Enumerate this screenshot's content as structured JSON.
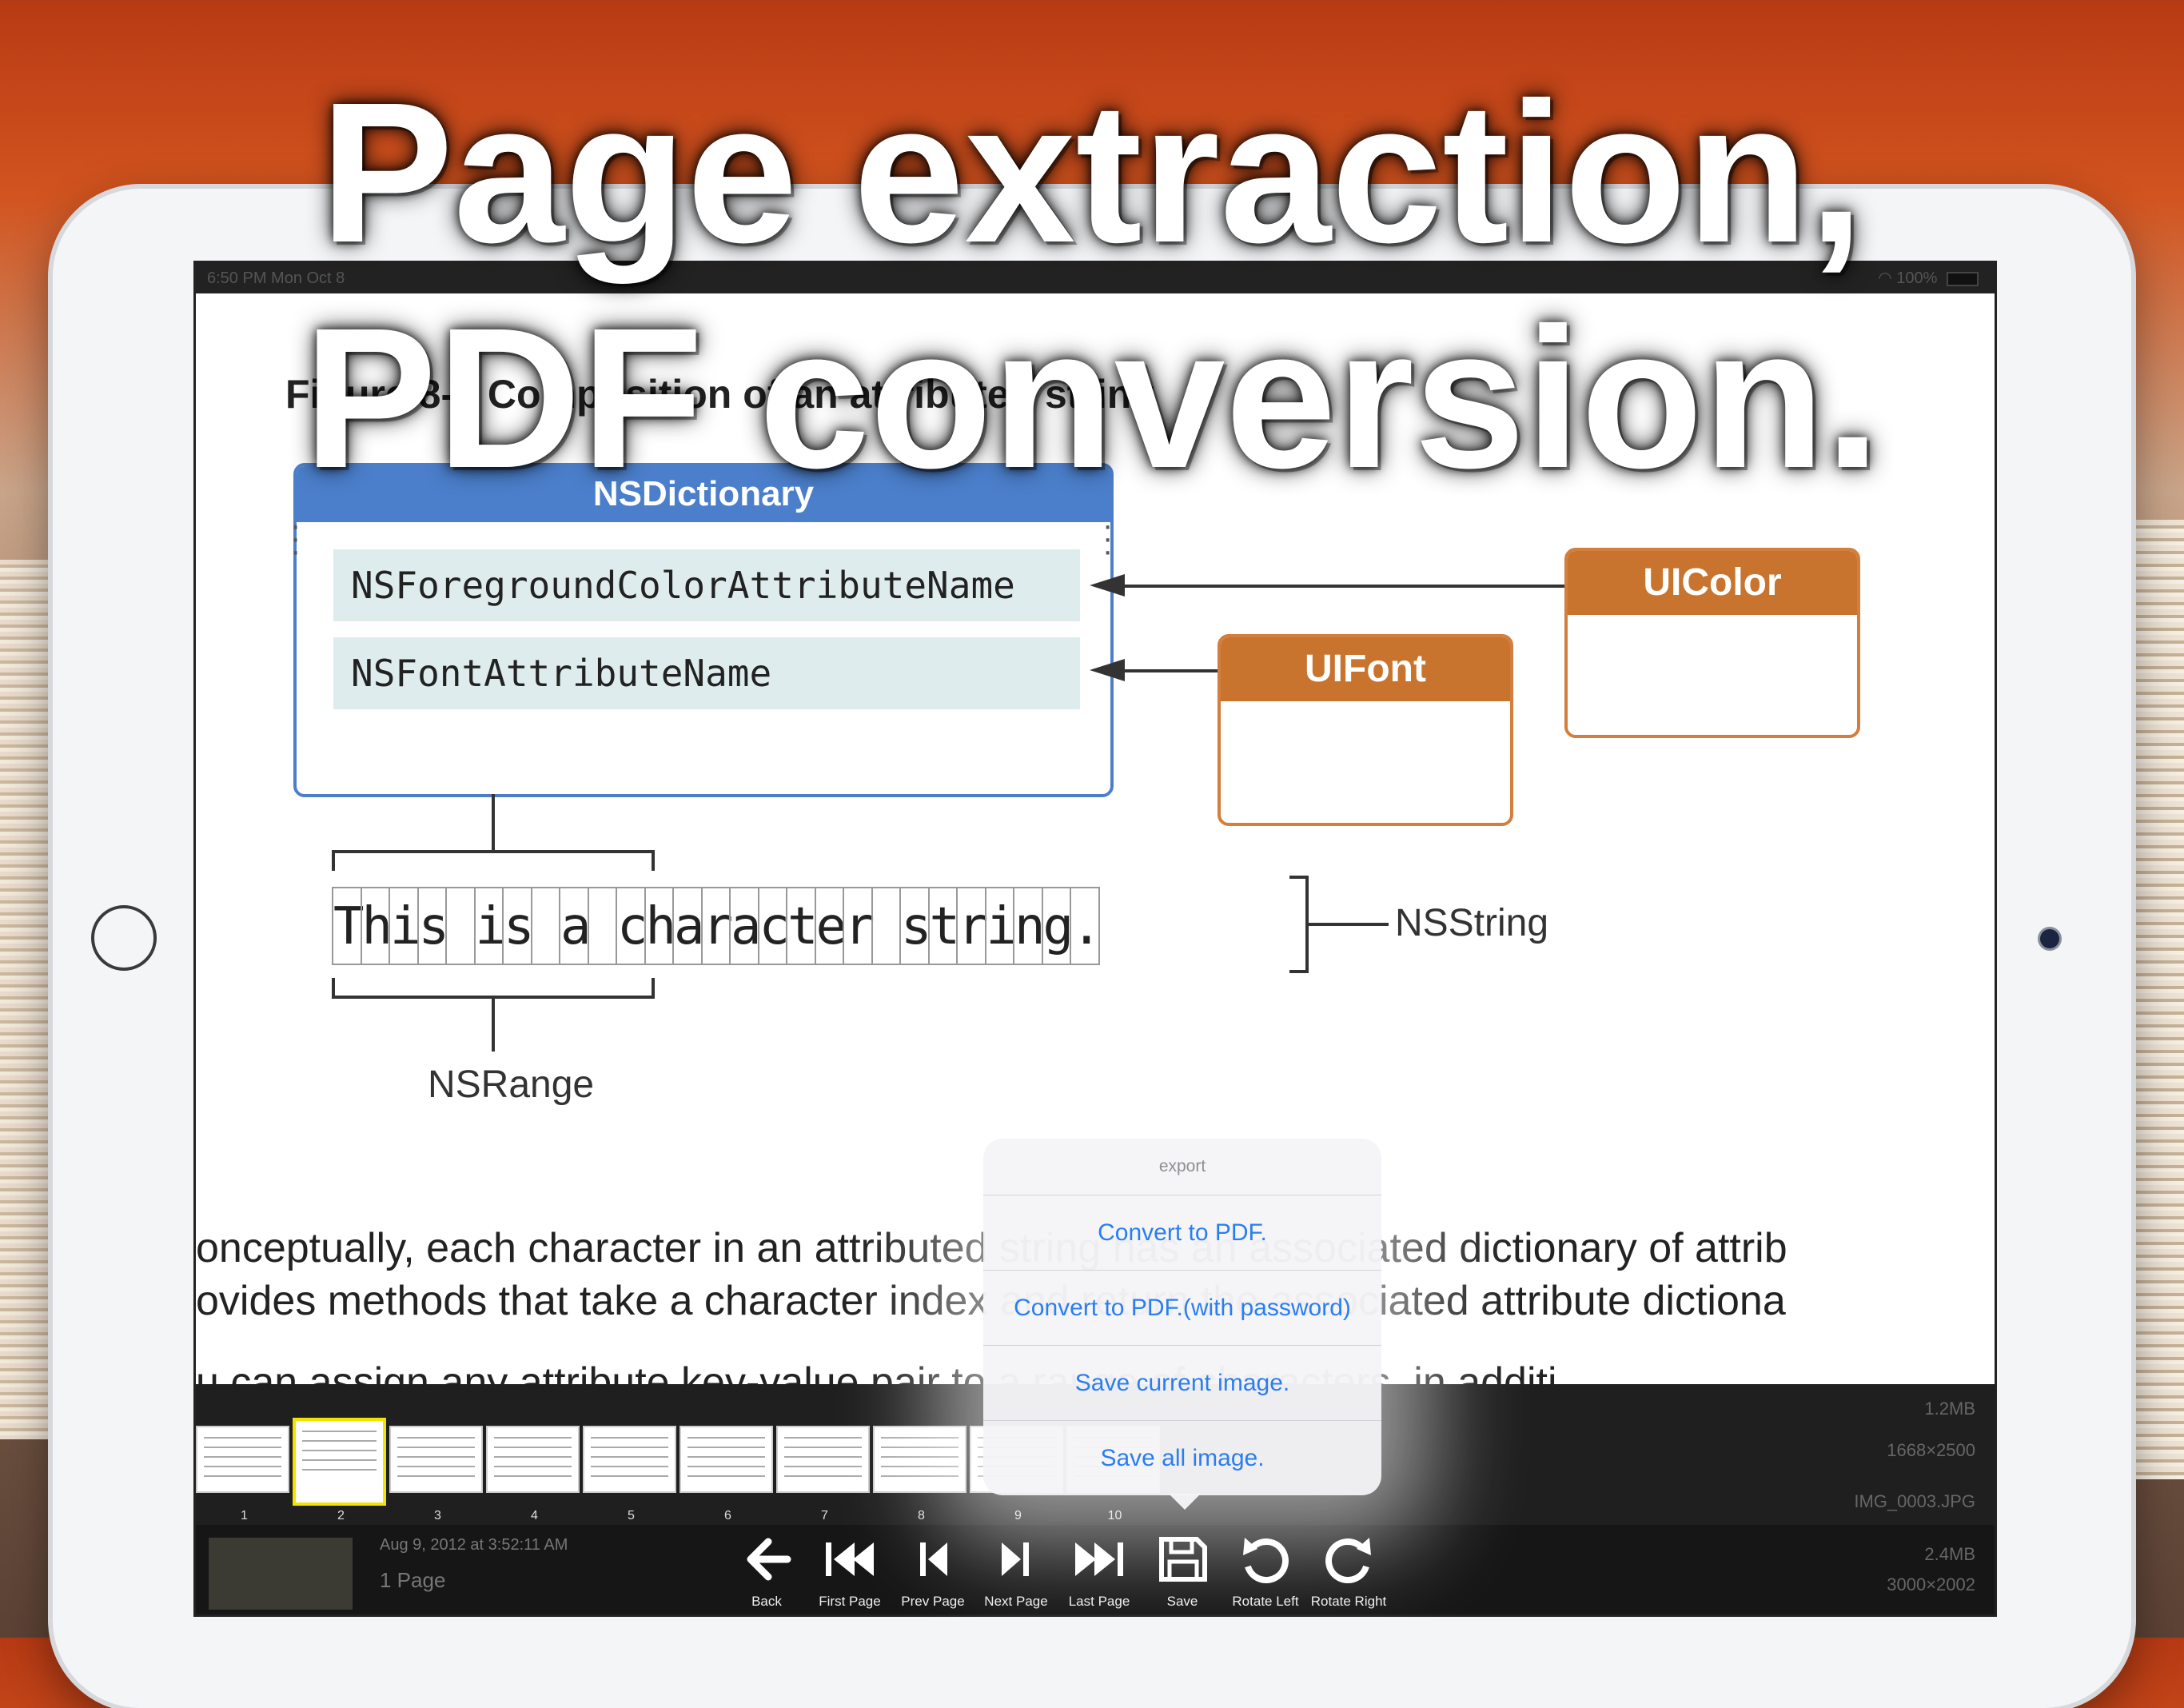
{
  "headline": {
    "line1": "Page extraction,",
    "line2": "PDF conversion."
  },
  "statusbar": {
    "time": "6:50 PM  Mon Oct 8",
    "battery": "100%"
  },
  "document": {
    "figure_caption": "Figure 8-3  Composition of an attributed string",
    "dictionary_title": "NSDictionary",
    "dict_row1": "NSForegroundColorAttributeName",
    "dict_row2": "NSFontAttributeName",
    "uicolor_title": "UIColor",
    "uifont_title": "UIFont",
    "char_string": "This is a character string.",
    "nsstring_label": "NSString",
    "nsrange_label": "NSRange",
    "para_line1": "onceptually, each character in an attributed string has an associated dictionary of attrib",
    "para_line2": "ovides methods that take a character index and return the associated attribute dictiona",
    "para_line3": "u can assign any attribute key-value pair to a range of characters, in additi"
  },
  "thumbnails": {
    "numbers": [
      "1",
      "2",
      "3",
      "4",
      "5",
      "6",
      "7",
      "8",
      "9",
      "10"
    ],
    "selected": 2
  },
  "meta": {
    "date": "Aug 9, 2012 at 3:52:11 AM",
    "page_count": "1 Page",
    "size1": "1.2MB",
    "dims1": "1668×2500",
    "filename": "IMG_0003.JPG",
    "size2": "2.4MB",
    "dims2": "3000×2002"
  },
  "export_menu": {
    "title": "export",
    "options": [
      "Convert to PDF.",
      "Convert to PDF.(with password)",
      "Save current image.",
      "Save all image."
    ]
  },
  "toolbar": {
    "back": "Back",
    "first_page": "First Page",
    "prev_page": "Prev Page",
    "next_page": "Next Page",
    "last_page": "Last Page",
    "save": "Save",
    "rotate_left": "Rotate Left",
    "rotate_right": "Rotate Right"
  },
  "colors": {
    "accent_blue": "#2a7ef0",
    "dict_blue": "#4b7fcb",
    "class_orange": "#c8742f",
    "selected_thumb": "#f0e400"
  }
}
